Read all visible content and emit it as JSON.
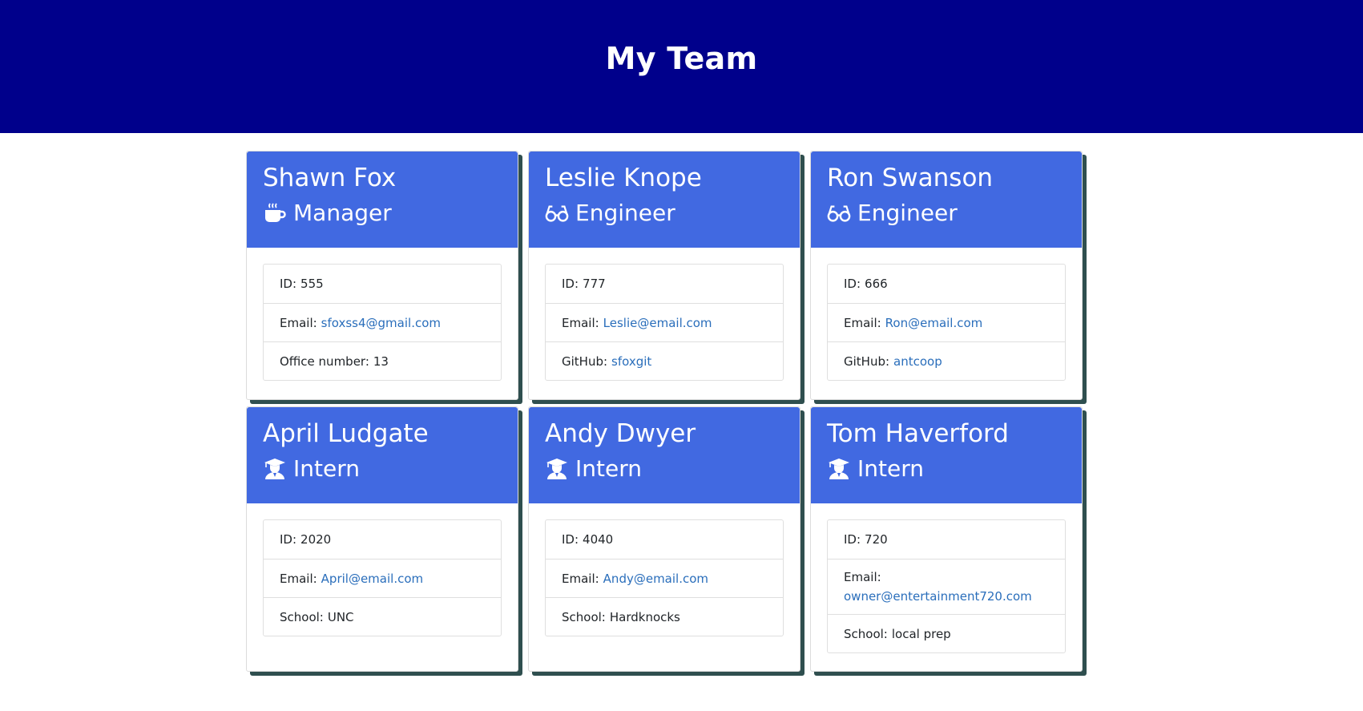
{
  "header": {
    "title": "My Team"
  },
  "employees": [
    {
      "name": "Shawn Fox",
      "role": "Manager",
      "icon": "coffee-icon",
      "id_label": "ID:",
      "id": "555",
      "email_label": "Email:",
      "email": "sfoxss4@gmail.com",
      "extra_label": "Office number:",
      "extra": "13"
    },
    {
      "name": "Leslie Knope",
      "role": "Engineer",
      "icon": "glasses-icon",
      "id_label": "ID:",
      "id": "777",
      "email_label": "Email:",
      "email": "Leslie@email.com",
      "extra_label": "GitHub:",
      "extra": "sfoxgit"
    },
    {
      "name": "Ron Swanson",
      "role": "Engineer",
      "icon": "glasses-icon",
      "id_label": "ID:",
      "id": "666",
      "email_label": "Email:",
      "email": "Ron@email.com",
      "extra_label": "GitHub:",
      "extra": "antcoop"
    },
    {
      "name": "April Ludgate",
      "role": "Intern",
      "icon": "graduate-icon",
      "id_label": "ID:",
      "id": "2020",
      "email_label": "Email:",
      "email": "April@email.com",
      "extra_label": "School:",
      "extra": "UNC"
    },
    {
      "name": "Andy Dwyer",
      "role": "Intern",
      "icon": "graduate-icon",
      "id_label": "ID:",
      "id": "4040",
      "email_label": "Email:",
      "email": "Andy@email.com",
      "extra_label": "School:",
      "extra": "Hardknocks"
    },
    {
      "name": "Tom Haverford",
      "role": "Intern",
      "icon": "graduate-icon",
      "id_label": "ID:",
      "id": "720",
      "email_label": "Email:",
      "email": "owner@entertainment720.com",
      "extra_label": "School:",
      "extra": "local prep"
    }
  ],
  "colors": {
    "banner": "#00008b",
    "card_header": "#4169e1",
    "link": "#2a6ebb",
    "shadow": "#2f4f4f"
  }
}
